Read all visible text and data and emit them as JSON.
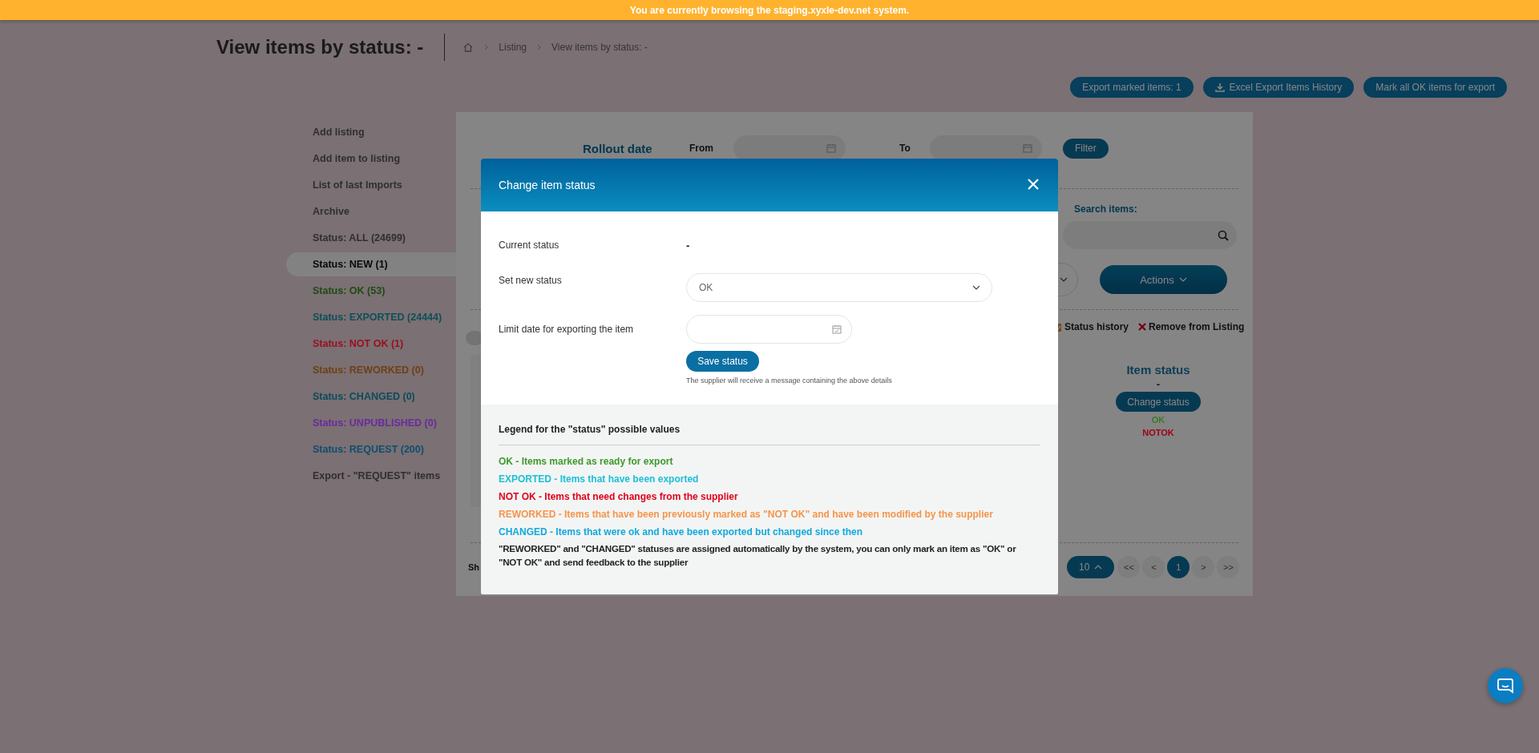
{
  "banner": {
    "text": "You are currently browsing the staging.xyxle-dev.net system."
  },
  "page_title": "View items by status: -",
  "breadcrumb": [
    "Listing",
    "View items by status: -"
  ],
  "top_buttons": [
    {
      "label": "Export marked items: 1",
      "kind": "plain"
    },
    {
      "label": "Excel Export Items History",
      "kind": "download"
    },
    {
      "label": "Mark all OK items for export",
      "kind": "plain"
    }
  ],
  "sidebar": {
    "items": [
      {
        "label": "Add listing",
        "color": "#5a5a5a",
        "selected": false
      },
      {
        "label": "Add item to listing",
        "color": "#5a5a5a",
        "selected": false
      },
      {
        "label": "List of last Imports",
        "color": "#5a5a5a",
        "selected": false
      },
      {
        "label": "Archive",
        "color": "#5a5a5a",
        "selected": false
      },
      {
        "label": "Status: ALL (24699)",
        "color": "#5a5a5a",
        "selected": false
      },
      {
        "label": "Status: NEW (1)",
        "color": "#111111",
        "selected": true
      },
      {
        "label": "Status: OK (53)",
        "color": "#1f4a14",
        "selected": false
      },
      {
        "label": "Status: EXPORTED (24444)",
        "color": "#0d4f58",
        "selected": false
      },
      {
        "label": "Status: NOT OK (1)",
        "color": "#9a0f1f",
        "selected": false
      },
      {
        "label": "Status: REWORKED (0)",
        "color": "#6e3f16",
        "selected": false
      },
      {
        "label": "Status: CHANGED (0)",
        "color": "#0c4a5c",
        "selected": false
      },
      {
        "label": "Status: UNPUBLISHED (0)",
        "color": "#6a2aa0",
        "selected": false
      },
      {
        "label": "Status: REQUEST (200)",
        "color": "#0d4e70",
        "selected": false
      },
      {
        "label": "Export - \"REQUEST\" items",
        "color": "#5a5a5a",
        "selected": false
      }
    ]
  },
  "panel": {
    "rollout_label": "Rollout date",
    "from_label": "From",
    "to_label": "To",
    "filter_button": "Filter",
    "search_label": "Search items:",
    "actions_button": "Actions",
    "row_links": [
      {
        "label": "Status history",
        "kind": "history"
      },
      {
        "label": "Remove from Listing",
        "kind": "remove"
      }
    ],
    "item_status": {
      "heading": "Item status",
      "value": "-",
      "button": "Change status",
      "options": [
        {
          "label": "OK",
          "color": "#3a7a2a"
        },
        {
          "label": "NOTOK",
          "color": "#a00018"
        }
      ]
    },
    "footer_text": "Sh",
    "page_size": "10",
    "pager": [
      {
        "label": "<<",
        "selected": false
      },
      {
        "label": "<",
        "selected": false
      },
      {
        "label": "1",
        "selected": true
      },
      {
        "label": ">",
        "selected": false
      },
      {
        "label": ">>",
        "selected": false
      }
    ]
  },
  "modal": {
    "title": "Change item status",
    "current_status": {
      "label": "Current status",
      "value": "-"
    },
    "new_status": {
      "label": "Set new status",
      "value": "OK"
    },
    "limit_date": {
      "label": "Limit date for exporting the item"
    },
    "save_button": "Save status",
    "note": "The supplier will receive a message containing the above details",
    "legend": {
      "title": "Legend for the \"status\" possible values",
      "items": [
        {
          "text": "OK - Items marked as ready for export",
          "color": "#3e9a2c"
        },
        {
          "text": "EXPORTED - Items that have been exported",
          "color": "#1cbfd6"
        },
        {
          "text": "NOT OK - Items that need changes from the supplier",
          "color": "#e0001b"
        },
        {
          "text": "REWORKED - Items that have been previously marked as \"NOT OK\" and have been modified by the supplier",
          "color": "#f6954a"
        },
        {
          "text": "CHANGED - Items that were ok and have been exported but changed since then",
          "color": "#13a8dc"
        }
      ],
      "footnote": "\"REWORKED\" and \"CHANGED\" statuses are assigned automatically by the system, you can only mark an item as \"OK\" or \"NOT OK\" and send feedback to the supplier"
    }
  }
}
